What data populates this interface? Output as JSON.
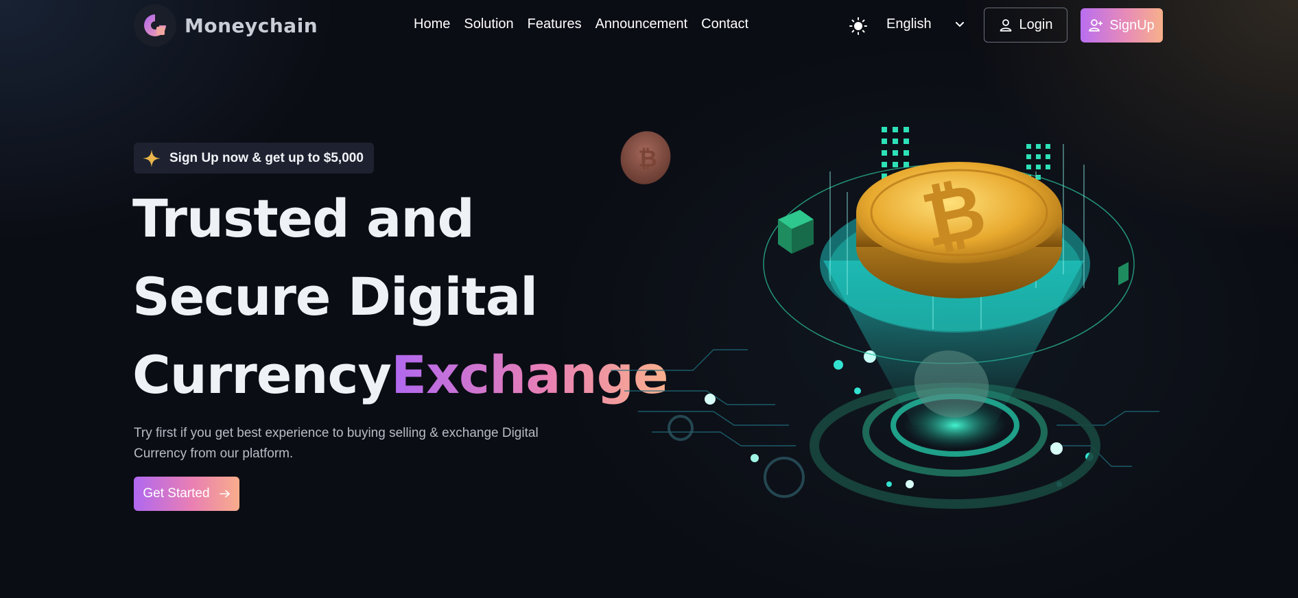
{
  "brand": {
    "name": "Moneychain"
  },
  "nav": {
    "items": [
      "Home",
      "Solution",
      "Features",
      "Announcement",
      "Contact"
    ],
    "language": "English",
    "login_label": "Login",
    "signup_label": "SignUp"
  },
  "hero": {
    "badge": "Sign Up now & get up to $5,000",
    "title_line1": "Trusted and",
    "title_line2": "Secure Digital",
    "title_line3_plain": "Currency",
    "title_line3_gradient": "Exchange",
    "description": "Try first if you get best experience to buying selling & exchange Digital Currency from our platform.",
    "cta_label": "Get Started"
  },
  "icons": {
    "theme": "sun-icon",
    "language_chevron": "chevron-down-icon",
    "login": "user-icon",
    "signup": "user-plus-icon",
    "badge": "sparkle-icon",
    "cta": "arrow-right-icon"
  },
  "colors": {
    "background": "#0b0d14",
    "accent_gradient_start": "#b068f0",
    "accent_gradient_mid": "#e77fb5",
    "accent_gradient_end": "#f9b08c",
    "teal": "#27e0c0",
    "gold": "#e8b03a"
  }
}
